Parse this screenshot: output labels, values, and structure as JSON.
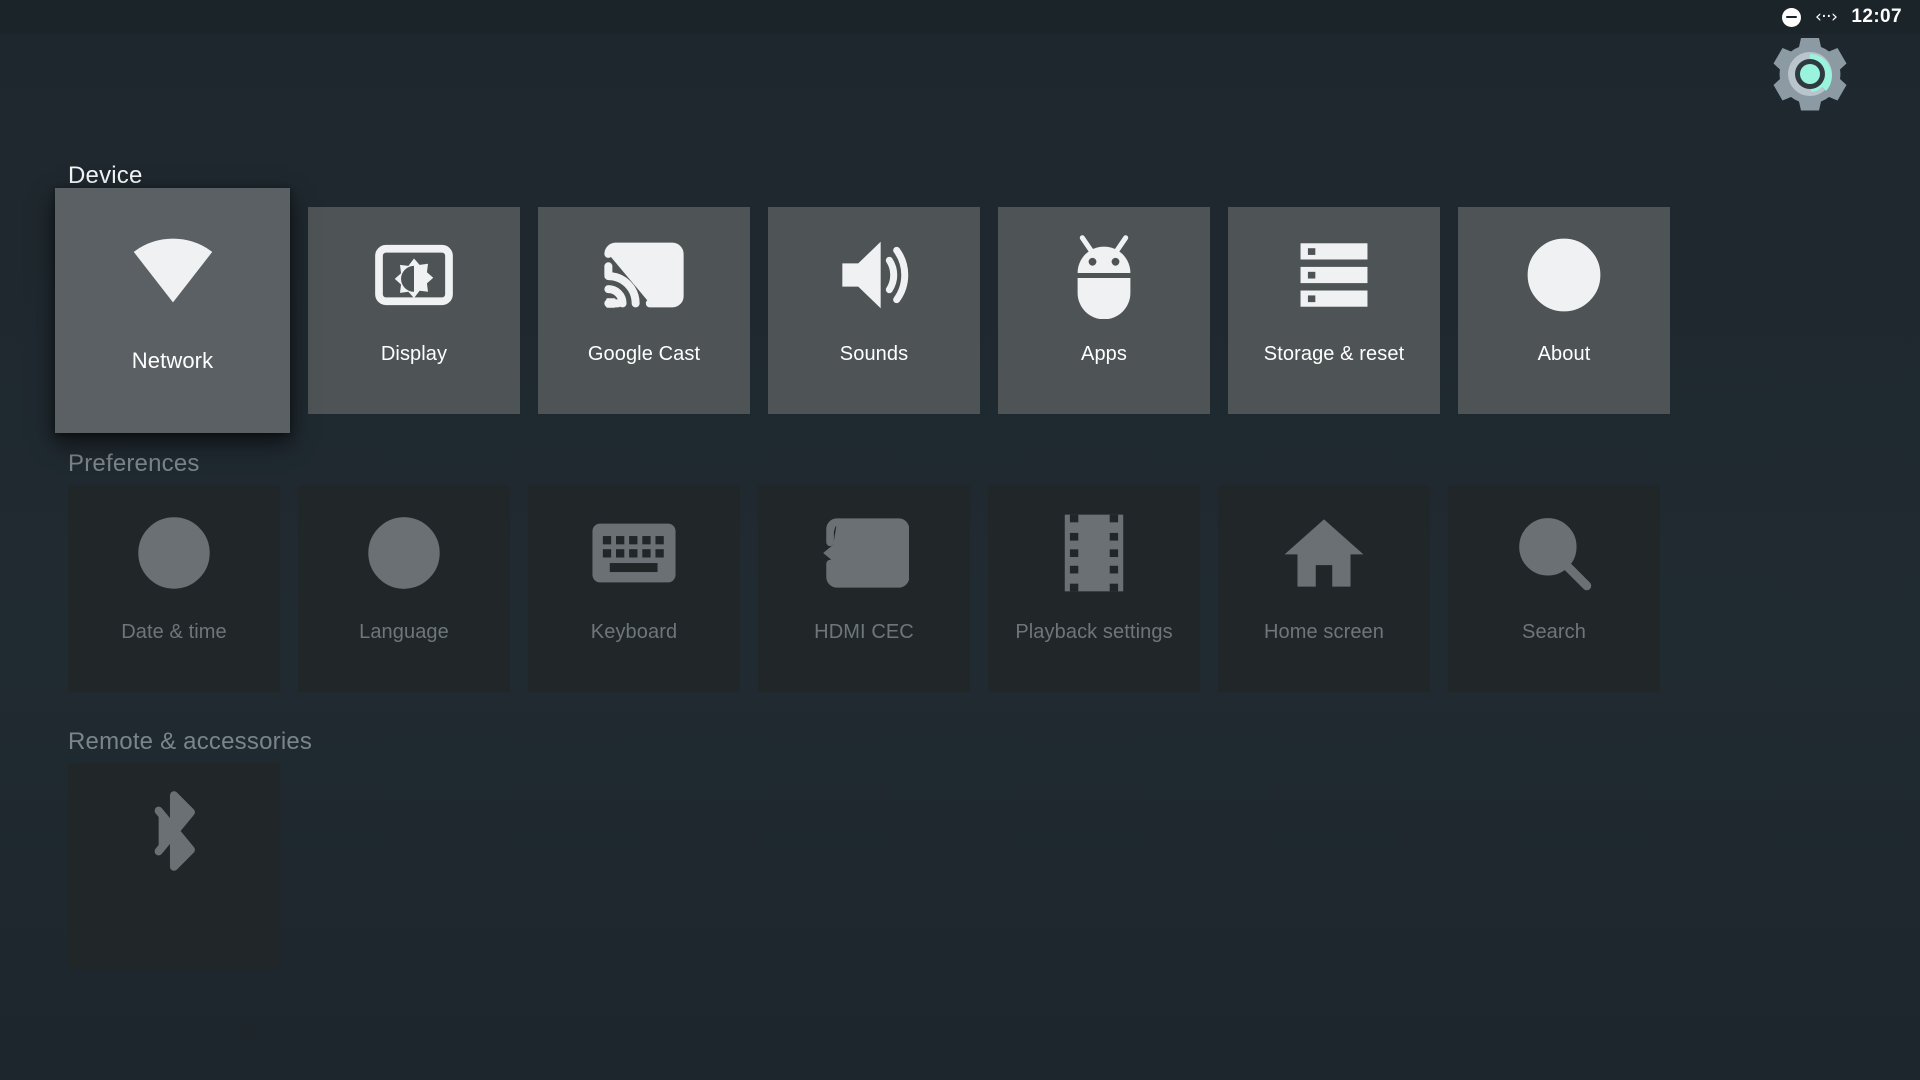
{
  "status_bar": {
    "time": "12:07",
    "icons": [
      {
        "name": "do-not-disturb-icon",
        "glyph": "⊖"
      },
      {
        "name": "ethernet-icon",
        "glyph": "‹··›"
      }
    ]
  },
  "brand": {
    "logo_name": "settings-gear-logo",
    "gear_color": "#8b9aa3",
    "accent_color": "#9af4dd",
    "ring_color": "#b9c4cb"
  },
  "rows": [
    {
      "header": "Device",
      "state": "focused",
      "tiles": [
        {
          "label": "Network",
          "icon": "wifi-icon",
          "focused": true
        },
        {
          "label": "Display",
          "icon": "brightness-icon",
          "focused": false
        },
        {
          "label": "Google Cast",
          "icon": "cast-icon",
          "focused": false
        },
        {
          "label": "Sounds",
          "icon": "volume-icon",
          "focused": false
        },
        {
          "label": "Apps",
          "icon": "android-icon",
          "focused": false
        },
        {
          "label": "Storage & reset",
          "icon": "storage-icon",
          "focused": false
        },
        {
          "label": "About",
          "icon": "info-icon",
          "focused": false
        }
      ]
    },
    {
      "header": "Preferences",
      "state": "dim",
      "tiles": [
        {
          "label": "Date & time",
          "icon": "clock-icon",
          "focused": false
        },
        {
          "label": "Language",
          "icon": "globe-icon",
          "focused": false
        },
        {
          "label": "Keyboard",
          "icon": "keyboard-icon",
          "focused": false
        },
        {
          "label": "HDMI CEC",
          "icon": "hdmi-cec-icon",
          "focused": false
        },
        {
          "label": "Playback settings",
          "icon": "filmstrip-icon",
          "focused": false
        },
        {
          "label": "Home screen",
          "icon": "home-icon",
          "focused": false
        },
        {
          "label": "Search",
          "icon": "search-icon",
          "focused": false
        }
      ]
    },
    {
      "header": "Remote & accessories",
      "state": "dim",
      "tiles": [
        {
          "label": "",
          "icon": "bluetooth-icon",
          "focused": false
        }
      ]
    }
  ],
  "colors": {
    "background": "#1f282e",
    "statusbar": "#1b2429",
    "tile_bright": "#4e5356",
    "tile_focused": "#5a6063",
    "tile_dim": "#212729",
    "text_bright": "#ffffff",
    "text_dim": "#6e767b",
    "header_dim": "#7b848a"
  }
}
